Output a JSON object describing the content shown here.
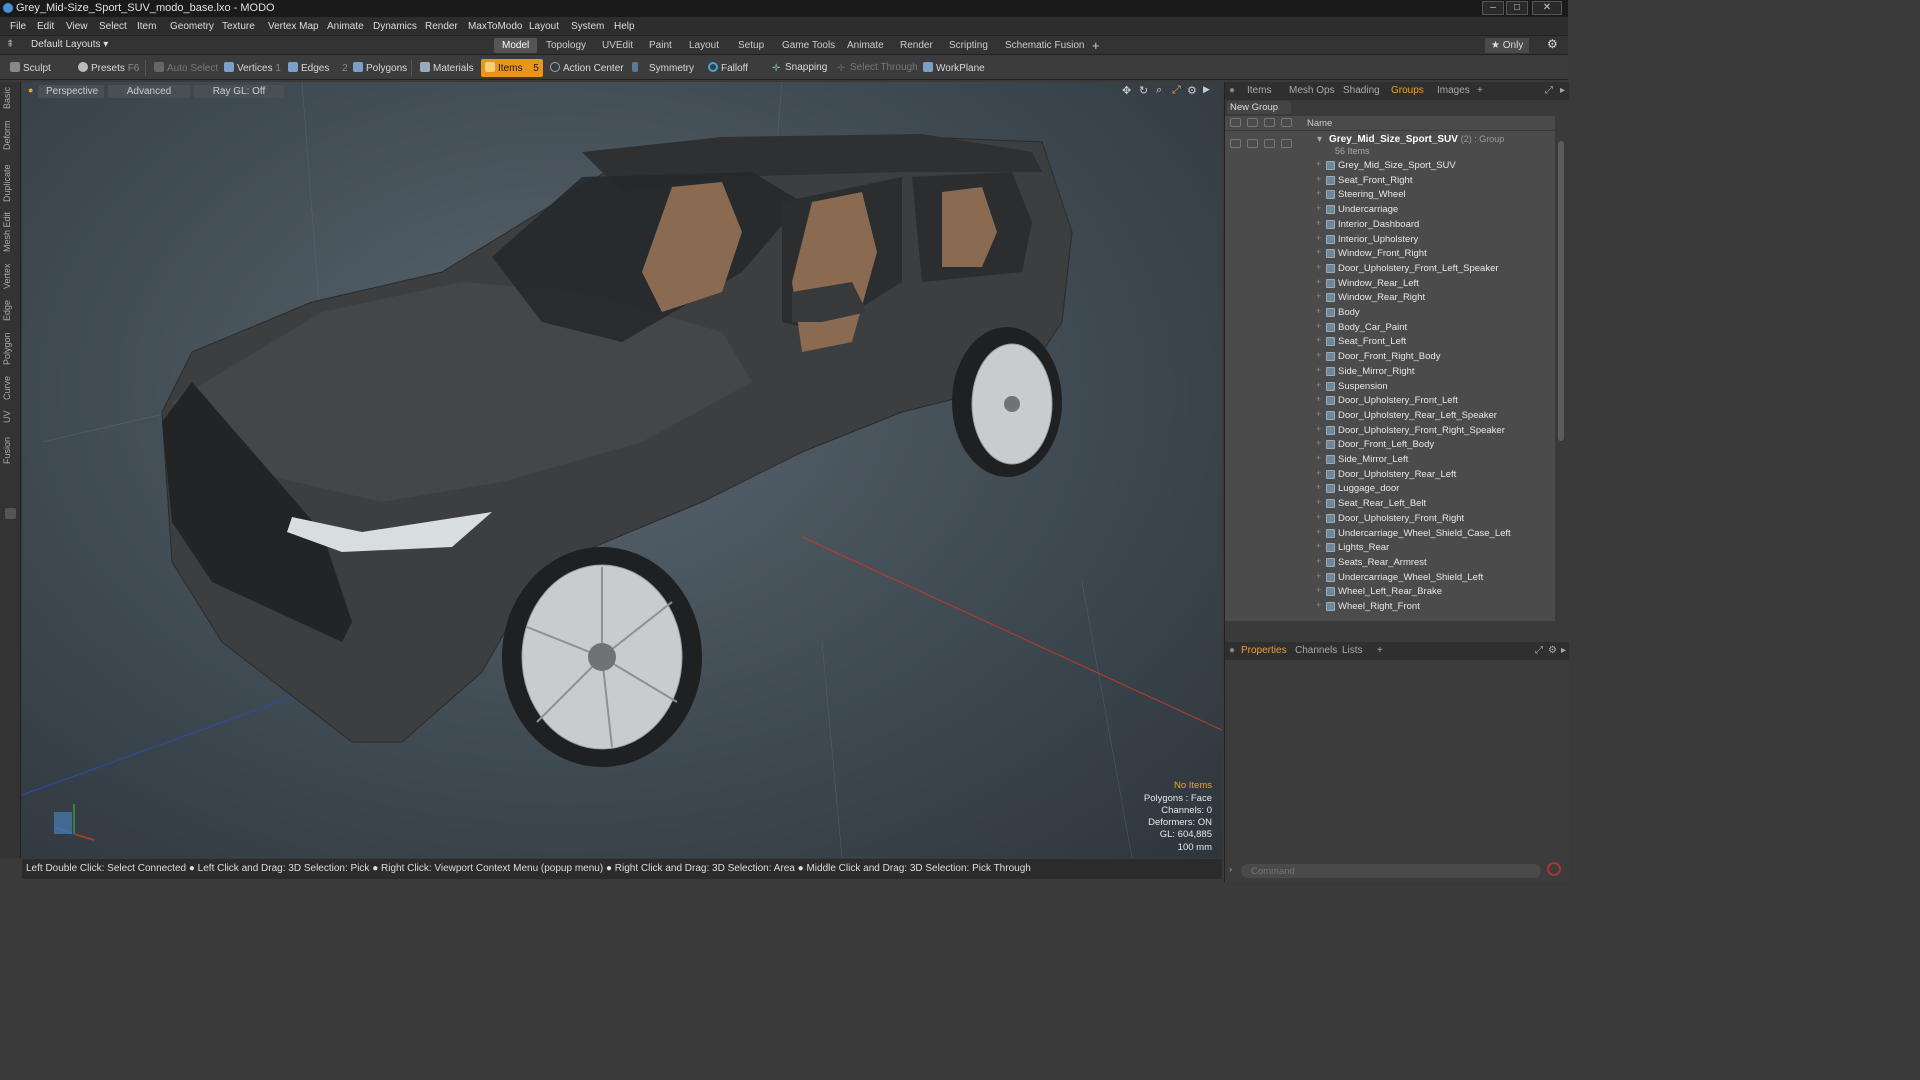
{
  "window": {
    "title": "Grey_Mid-Size_Sport_SUV_modo_base.lxo - MODO"
  },
  "menu": [
    "File",
    "Edit",
    "View",
    "Select",
    "Item",
    "Geometry",
    "Texture",
    "Vertex Map",
    "Animate",
    "Dynamics",
    "Render",
    "MaxToModo",
    "Layout",
    "System",
    "Help"
  ],
  "layouts": {
    "label": "Default Layouts ▾"
  },
  "tabs": [
    "Model",
    "Topology",
    "UVEdit",
    "Paint",
    "Layout",
    "Setup",
    "Game Tools",
    "Animate",
    "Render",
    "Scripting",
    "Schematic Fusion",
    "+"
  ],
  "only_label": "★ Only",
  "toolbar": {
    "sculpt": "Sculpt",
    "presets": "Presets",
    "presets_key": "F6",
    "auto_select": "Auto Select",
    "vertices": "Vertices",
    "vertices_count": "1",
    "edges": "Edges",
    "edges_count": "2",
    "polygons": "Polygons",
    "materials": "Materials",
    "items": "Items",
    "items_count": "5",
    "action_center": "Action Center",
    "symmetry": "Symmetry",
    "falloff": "Falloff",
    "snapping": "Snapping",
    "select_through": "Select Through",
    "workplane": "WorkPlane"
  },
  "left_tabs": [
    "Basic",
    "Deform",
    "Duplicate",
    "Mesh Edit",
    "Vertex",
    "Edge",
    "Polygon",
    "Curve",
    "UV",
    "Fusion"
  ],
  "viewport": {
    "view": "Perspective",
    "shading": "Advanced",
    "raygl": "Ray GL: Off",
    "info": {
      "no_items": "No Items",
      "polygons": "Polygons : Face",
      "channels": "Channels: 0",
      "deformers": "Deformers: ON",
      "gl": "GL: 604,885",
      "scale": "100 mm"
    }
  },
  "status": "Left Double Click: Select Connected ● Left Click and Drag: 3D Selection: Pick ● Right Click: Viewport Context Menu (popup menu) ● Right Click and Drag: 3D Selection: Area ● Middle Click and Drag: 3D Selection: Pick Through",
  "right_panel": {
    "tabs": [
      "Items",
      "Mesh Ops",
      "Shading",
      "Groups",
      "Images",
      "+"
    ],
    "active_tab": "Groups",
    "new_group": "New Group",
    "col_name": "Name",
    "group": {
      "name": "Grey_Mid_Size_Sport_SUV",
      "suffix": "(2) : Group",
      "count": "56 Items"
    },
    "items": [
      "Grey_Mid_Size_Sport_SUV",
      "Seat_Front_Right",
      "Steering_Wheel",
      "Undercarriage",
      "Interior_Dashboard",
      "Interior_Upholstery",
      "Window_Front_Right",
      "Door_Upholstery_Front_Left_Speaker",
      "Window_Rear_Left",
      "Window_Rear_Right",
      "Body",
      "Body_Car_Paint",
      "Seat_Front_Left",
      "Door_Front_Right_Body",
      "Side_Mirror_Right",
      "Suspension",
      "Door_Upholstery_Front_Left",
      "Door_Upholstery_Rear_Left_Speaker",
      "Door_Upholstery_Front_Right_Speaker",
      "Door_Front_Left_Body",
      "Side_Mirror_Left",
      "Door_Upholstery_Rear_Left",
      "Luggage_door",
      "Seat_Rear_Left_Belt",
      "Door_Upholstery_Front_Right",
      "Undercarriage_Wheel_Shield_Case_Left",
      "Lights_Rear",
      "Seats_Rear_Armrest",
      "Undercarriage_Wheel_Shield_Left",
      "Wheel_Left_Rear_Brake",
      "Wheel_Right_Front"
    ],
    "bottom_tabs": [
      "Properties",
      "Channels",
      "Lists",
      "+"
    ],
    "command_placeholder": "Command"
  },
  "colors": {
    "accent": "#e8951c",
    "viewport_bg": "#46525a",
    "panel_bg": "#4b4b4b"
  }
}
